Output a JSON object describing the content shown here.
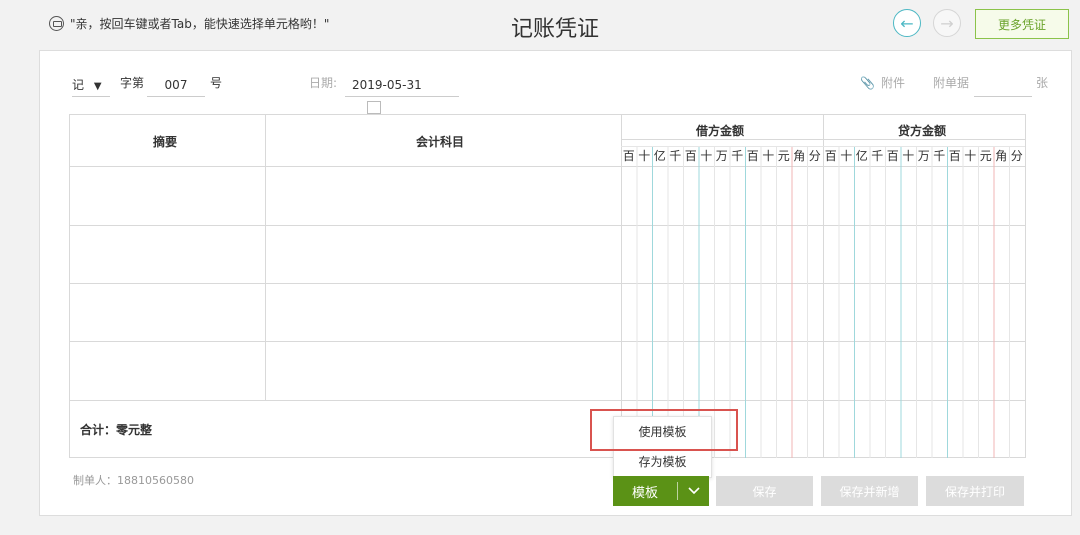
{
  "header": {
    "hint_text": "\"亲，按回车键或者Tab，能快速选择单元格哟！\"",
    "title": "记账凭证",
    "more_label": "更多凭证"
  },
  "voucher": {
    "word": "记",
    "word_suffix": "字第",
    "number": "007",
    "number_suffix": "号",
    "date_label": "日期:",
    "date_value": "2019-05-31",
    "attach_label": "附件",
    "docs_label": "附单据",
    "docs_suffix": "张"
  },
  "table": {
    "col_summary": "摘要",
    "col_account": "会计科目",
    "col_debit": "借方金额",
    "col_credit": "贷方金额",
    "digits": [
      "百",
      "十",
      "亿",
      "千",
      "百",
      "十",
      "万",
      "千",
      "百",
      "十",
      "元",
      "角",
      "分"
    ],
    "total_text": "合计：零元整"
  },
  "footer": {
    "maker": "制单人：18810560580",
    "template_label": "模板",
    "dropdown": [
      "使用模板",
      "存为模板"
    ],
    "save": "保存",
    "save_new": "保存并新增",
    "save_print": "保存并打印"
  },
  "colors": {
    "accent_green": "#5b9216",
    "nav_teal": "#4cb8c4",
    "highlight_red": "#d9534f"
  }
}
